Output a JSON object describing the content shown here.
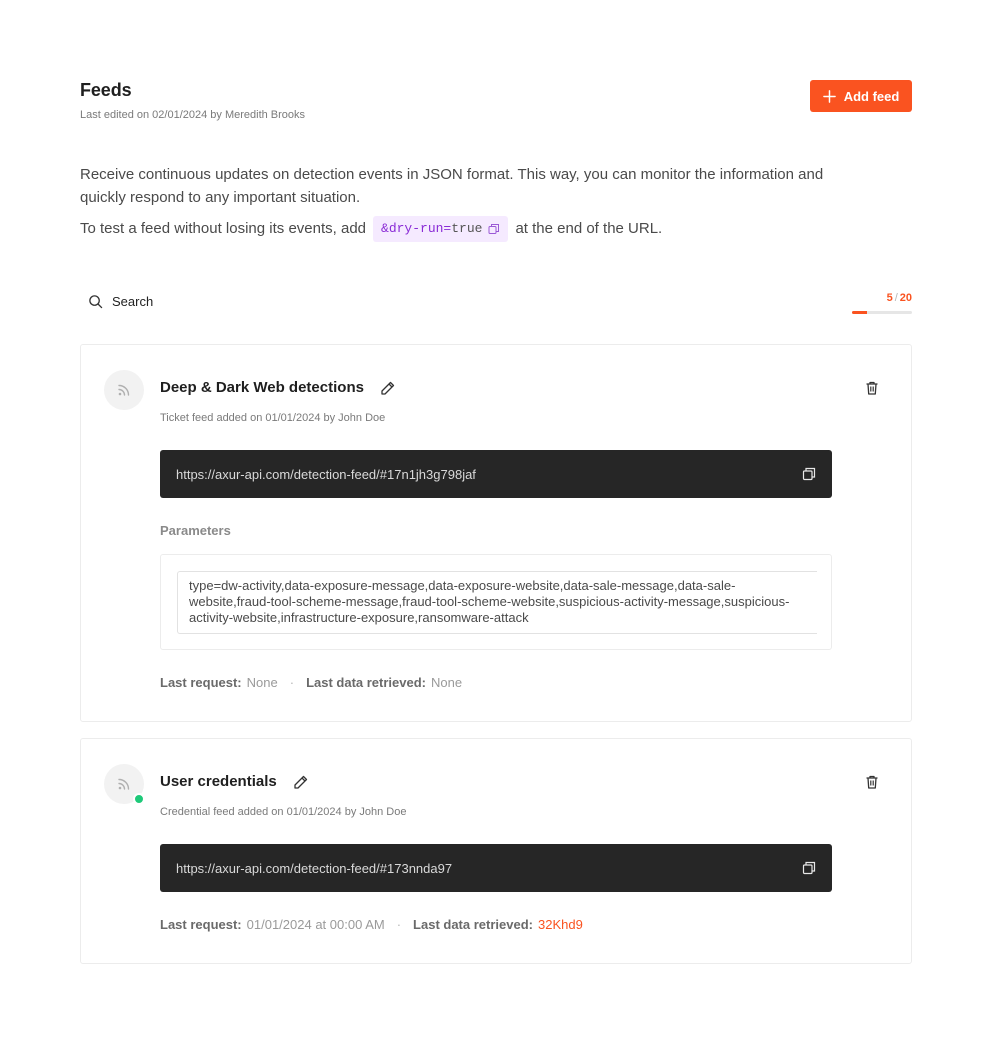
{
  "header": {
    "title": "Feeds",
    "last_edited": "Last edited on 02/01/2024 by Meredith Brooks",
    "add_button": "Add feed"
  },
  "description": {
    "line1": "Receive continuous updates on detection events in JSON format. This way, you can monitor the information and quickly respond to any important situation.",
    "line2_before": "To test a feed without losing its events, add",
    "code_key": "&dry-run=",
    "code_value": "true",
    "line2_after": "at the end of the URL."
  },
  "search": {
    "label": "Search"
  },
  "quota": {
    "used": "5",
    "separator": "/",
    "total": "20",
    "fraction": 0.25
  },
  "feeds": [
    {
      "name": "Deep & Dark Web detections",
      "subtitle": "Ticket feed added on 01/01/2024 by John Doe",
      "url": "https://axur-api.com/detection-feed/#17n1jh3g798jaf",
      "active": false,
      "parameters_label": "Parameters",
      "parameters": "type=dw-activity,data-exposure-message,data-exposure-website,data-sale-message,data-sale-website,fraud-tool-scheme-message,fraud-tool-scheme-website,suspicious-activity-message,suspicious-activity-website,infrastructure-exposure,ransomware-attack",
      "last_request_label": "Last request:",
      "last_request": "None",
      "last_data_label": "Last data retrieved:",
      "last_data": "None"
    },
    {
      "name": "User credentials",
      "subtitle": "Credential feed added on 01/01/2024 by John Doe",
      "url": "https://axur-api.com/detection-feed/#173nnda97",
      "active": true,
      "last_request_label": "Last request:",
      "last_request": "01/01/2024 at 00:00 AM",
      "last_data_label": "Last data retrieved:",
      "last_data": "32Khd9"
    }
  ],
  "colors": {
    "accent": "#fa5320",
    "active_dot": "#1ec979",
    "url_bg": "#262626",
    "chip_bg": "#f5eaff",
    "chip_key": "#8a2bd6"
  },
  "icons": [
    "plus-icon",
    "copy-icon",
    "search-icon",
    "rss-icon",
    "edit-icon",
    "trash-icon"
  ]
}
